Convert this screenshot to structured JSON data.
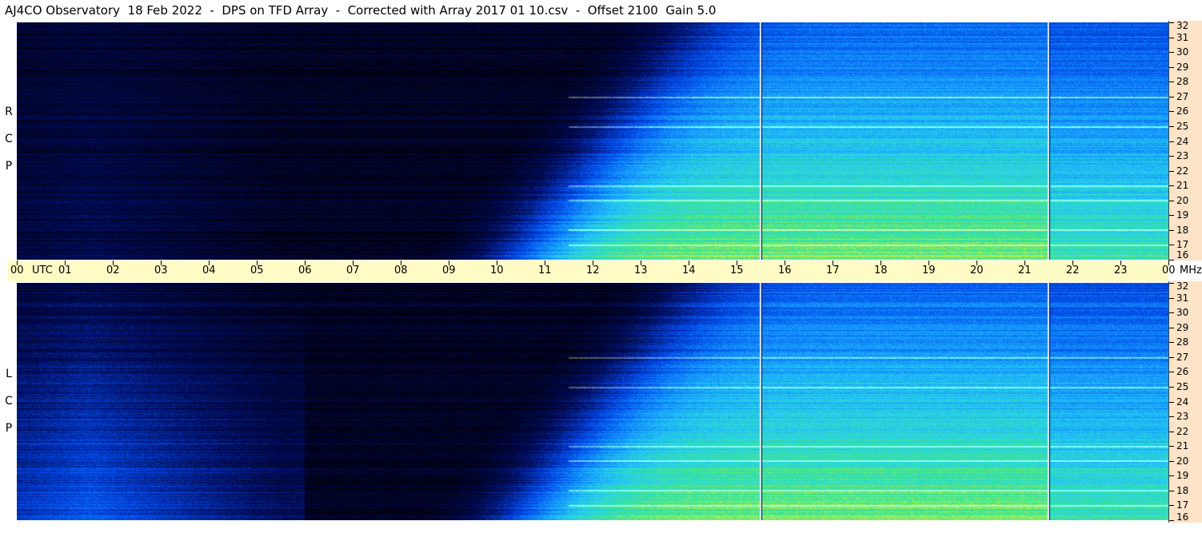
{
  "title": "AJ4CO Observatory  18 Feb 2022  -  DPS on TFD Array  -  Corrected with Array 2017 01 10.csv  -  Offset 2100  Gain 5.0",
  "panels": {
    "rcp_label": [
      "R",
      "C",
      "P"
    ],
    "lcp_label": [
      "L",
      "C",
      "P"
    ]
  },
  "time_axis": {
    "unit_label": "UTC",
    "labels": [
      "00",
      "01",
      "02",
      "03",
      "04",
      "05",
      "06",
      "07",
      "08",
      "09",
      "10",
      "11",
      "12",
      "13",
      "14",
      "15",
      "16",
      "17",
      "18",
      "19",
      "20",
      "21",
      "22",
      "23",
      "00"
    ],
    "range_hours": [
      0,
      24
    ]
  },
  "freq_axis": {
    "unit_label": "MHz",
    "labels": [
      "32",
      "31",
      "30",
      "29",
      "28",
      "27",
      "26",
      "25",
      "24",
      "23",
      "22",
      "21",
      "20",
      "19",
      "18",
      "17",
      "16"
    ],
    "range_mhz": [
      16,
      32
    ]
  },
  "chart_data": [
    {
      "type": "heatmap",
      "title": "AJ4CO Observatory  18 Feb 2022  -  DPS on TFD Array  -  Corrected with Array 2017 01 10.csv  -  Offset 2100  Gain 5.0",
      "panel": "RCP",
      "xlabel": "UTC",
      "ylabel": "MHz",
      "xlim": [
        0,
        24
      ],
      "ylim": [
        16,
        32
      ],
      "x_ticks": [
        "00",
        "01",
        "02",
        "03",
        "04",
        "05",
        "06",
        "07",
        "08",
        "09",
        "10",
        "11",
        "12",
        "13",
        "14",
        "15",
        "16",
        "17",
        "18",
        "19",
        "20",
        "21",
        "22",
        "23",
        "00"
      ],
      "y_ticks": [
        16,
        17,
        18,
        19,
        20,
        21,
        22,
        23,
        24,
        25,
        26,
        27,
        28,
        29,
        30,
        31,
        32
      ],
      "bright_bands_mhz": [
        27.0,
        25.0,
        21.0,
        20.0,
        18.0,
        17.0
      ],
      "gap_times_utc": [
        15.5,
        21.5
      ],
      "colors": [
        "#000010",
        "#001a8c",
        "#0060ff",
        "#20c8ff",
        "#30e080",
        "#f0f040",
        "#ff8020"
      ]
    },
    {
      "type": "heatmap",
      "panel": "LCP",
      "xlabel": "UTC",
      "ylabel": "MHz",
      "xlim": [
        0,
        24
      ],
      "ylim": [
        16,
        32
      ],
      "x_ticks": [
        "00",
        "01",
        "02",
        "03",
        "04",
        "05",
        "06",
        "07",
        "08",
        "09",
        "10",
        "11",
        "12",
        "13",
        "14",
        "15",
        "16",
        "17",
        "18",
        "19",
        "20",
        "21",
        "22",
        "23",
        "00"
      ],
      "y_ticks": [
        16,
        17,
        18,
        19,
        20,
        21,
        22,
        23,
        24,
        25,
        26,
        27,
        28,
        29,
        30,
        31,
        32
      ],
      "bright_bands_mhz": [
        27.0,
        25.0,
        21.0,
        20.0,
        18.0,
        17.0
      ],
      "gap_times_utc": [
        15.5,
        21.5
      ],
      "colors": [
        "#000010",
        "#001a8c",
        "#0060ff",
        "#20c8ff",
        "#30e080",
        "#f0f040",
        "#ff8020"
      ]
    }
  ]
}
